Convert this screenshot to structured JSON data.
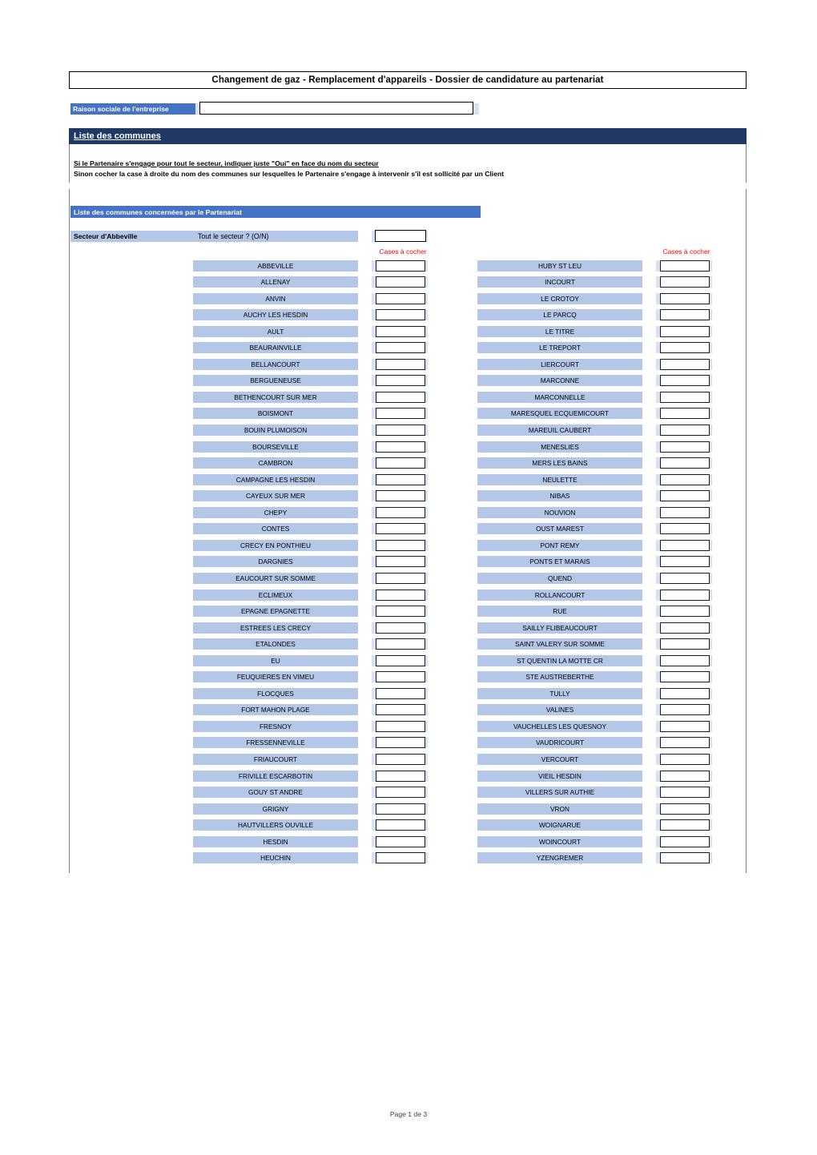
{
  "document": {
    "title": "Changement de gaz - Remplacement d'appareils - Dossier de candidature au partenariat",
    "footer": "Page 1 de 3"
  },
  "company": {
    "label": "Raison sociale de l'entreprise",
    "value": "",
    "placeholder": ""
  },
  "section": {
    "heading": "Liste des communes",
    "instruction_1": "Si le Partenaire s'engage pour tout le secteur, indiquer juste \"Oui\" en face du nom du secteur",
    "instruction_2": "Sinon cocher la case à droite du nom des communes sur lesquelles le Partenaire s'engage à intervenir s'il est sollicité par un Client",
    "subheading": "Liste des communes concernées par le Partenariat"
  },
  "sector": {
    "name": "Secteur d'Abbeville",
    "question": "Tout le secteur ? (O/N)",
    "value": ""
  },
  "checkbox_column_label": "Cases à cocher",
  "colors": {
    "navy": "#1F3864",
    "blue": "#4472C4",
    "cell_blue": "#B4C7E7",
    "pale_blue": "#D9E2F3",
    "red": "#FF0000"
  },
  "communes_left": [
    "ABBEVILLE",
    "ALLENAY",
    "ANVIN",
    "AUCHY LES HESDIN",
    "AULT",
    "BEAURAINVILLE",
    "BELLANCOURT",
    "BERGUENEUSE",
    "BETHENCOURT SUR MER",
    "BOISMONT",
    "BOUIN PLUMOISON",
    "BOURSEVILLE",
    "CAMBRON",
    "CAMPAGNE LES HESDIN",
    "CAYEUX SUR MER",
    "CHEPY",
    "CONTES",
    "CRECY EN PONTHIEU",
    "DARGNIES",
    "EAUCOURT SUR SOMME",
    "ECLIMEUX",
    "EPAGNE EPAGNETTE",
    "ESTREES LES CRECY",
    "ETALONDES",
    "EU",
    "FEUQUIERES EN VIMEU",
    "FLOCQUES",
    "FORT MAHON PLAGE",
    "FRESNOY",
    "FRESSENNEVILLE",
    "FRIAUCOURT",
    "FRIVILLE ESCARBOTIN",
    "GOUY ST ANDRE",
    "GRIGNY",
    "HAUTVILLERS OUVILLE",
    "HESDIN",
    "HEUCHIN"
  ],
  "communes_right": [
    "HUBY ST LEU",
    "INCOURT",
    "LE CROTOY",
    "LE PARCQ",
    "LE TITRE",
    "LE TREPORT",
    "LIERCOURT",
    "MARCONNE",
    "MARCONNELLE",
    "MARESQUEL ECQUEMICOURT",
    "MAREUIL CAUBERT",
    "MENESLIES",
    "MERS LES BAINS",
    "NEULETTE",
    "NIBAS",
    "NOUVION",
    "OUST MAREST",
    "PONT REMY",
    "PONTS ET MARAIS",
    "QUEND",
    "ROLLANCOURT",
    "RUE",
    "SAILLY FLIBEAUCOURT",
    "SAINT VALERY SUR SOMME",
    "ST QUENTIN LA MOTTE CR",
    "STE AUSTREBERTHE",
    "TULLY",
    "VALINES",
    "VAUCHELLES LES QUESNOY",
    "VAUDRICOURT",
    "VERCOURT",
    "VIEIL HESDIN",
    "VILLERS SUR AUTHIE",
    "VRON",
    "WOIGNARUE",
    "WOINCOURT",
    "YZENGREMER"
  ]
}
